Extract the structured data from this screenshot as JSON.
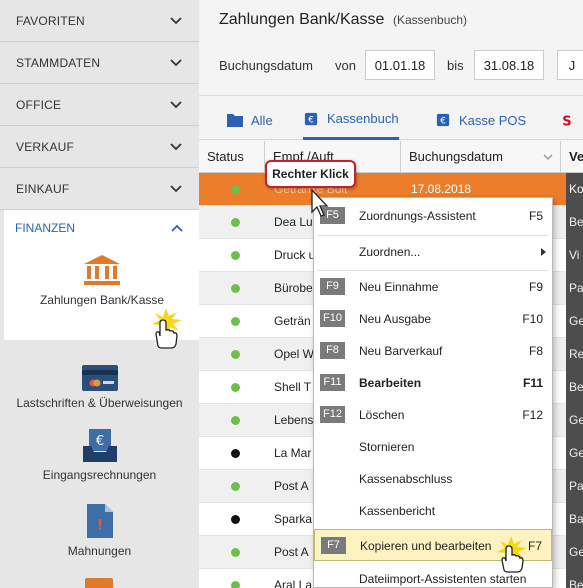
{
  "sidebar": {
    "sections": [
      {
        "label": "FAVORITEN"
      },
      {
        "label": "STAMMDATEN"
      },
      {
        "label": "OFFICE"
      },
      {
        "label": "VERKAUF"
      },
      {
        "label": "EINKAUF"
      }
    ],
    "finanzen": {
      "label": "FINANZEN",
      "active_item": "Zahlungen Bank/Kasse"
    },
    "items": [
      {
        "label": "Lastschriften & Überweisungen"
      },
      {
        "label": "Eingangsrechnungen"
      },
      {
        "label": "Mahnungen"
      }
    ]
  },
  "header": {
    "title": "Zahlungen Bank/Kasse",
    "subtitle": "(Kassenbuch)",
    "date_label": "Buchungsdatum",
    "from_label": "von",
    "from_value": "01.01.18",
    "to_label": "bis",
    "to_value": "31.08.18",
    "extra_button": "J"
  },
  "tabs": [
    {
      "label": "Alle"
    },
    {
      "label": "Kassenbuch"
    },
    {
      "label": "Kasse POS"
    }
  ],
  "table": {
    "headers": {
      "status": "Status",
      "empf": "Empf./Auft",
      "datum": "Buchungsdatum",
      "ver": "Ve"
    },
    "rows": [
      {
        "status": "green",
        "empf": "Getränke Bolt",
        "datum": "17.08.2018",
        "ver": "Ko"
      },
      {
        "status": "green",
        "empf": "Dea Lu",
        "datum": "",
        "ver": "Be"
      },
      {
        "status": "green",
        "empf": "Druck u",
        "datum": "",
        "ver": "Vi"
      },
      {
        "status": "green",
        "empf": "Bürobe",
        "datum": "",
        "ver": "Pa"
      },
      {
        "status": "green",
        "empf": "Geträn",
        "datum": "",
        "ver": "Ge"
      },
      {
        "status": "green",
        "empf": "Opel W",
        "datum": "",
        "ver": "Re"
      },
      {
        "status": "green",
        "empf": "Shell T",
        "datum": "",
        "ver": "Be"
      },
      {
        "status": "green",
        "empf": "Lebens",
        "datum": "",
        "ver": "Ge"
      },
      {
        "status": "black",
        "empf": "La Mar",
        "datum": "",
        "ver": "Ge"
      },
      {
        "status": "green",
        "empf": "Post A",
        "datum": "",
        "ver": "Pa"
      },
      {
        "status": "black",
        "empf": "Sparka",
        "datum": "",
        "ver": "Ba"
      },
      {
        "status": "green",
        "empf": "Post A",
        "datum": "",
        "ver": "Ge"
      },
      {
        "status": "green",
        "empf": "Aral La",
        "datum": "",
        "ver": "Be"
      }
    ]
  },
  "callout": "Rechter Klick",
  "context_menu": {
    "items": [
      {
        "key": "F5",
        "label": "Zuordnungs-Assistent",
        "shortcut": "F5"
      },
      {
        "key": "",
        "label": "Zuordnen...",
        "shortcut": ""
      },
      {
        "key": "F9",
        "label": "Neu Einnahme",
        "shortcut": "F9"
      },
      {
        "key": "F10",
        "label": "Neu Ausgabe",
        "shortcut": "F10"
      },
      {
        "key": "F8",
        "label": "Neu Barverkauf",
        "shortcut": "F8"
      },
      {
        "key": "F11",
        "label": "Bearbeiten",
        "shortcut": "F11"
      },
      {
        "key": "F12",
        "label": "Löschen",
        "shortcut": "F12"
      },
      {
        "key": "",
        "label": "Stornieren",
        "shortcut": ""
      },
      {
        "key": "",
        "label": "Kassenabschluss",
        "shortcut": ""
      },
      {
        "key": "",
        "label": "Kassenbericht",
        "shortcut": ""
      },
      {
        "key": "F7",
        "label": "Kopieren und bearbeiten",
        "shortcut": "F7"
      },
      {
        "key": "",
        "label": "Dateiimport-Assistenten starten",
        "shortcut": ""
      }
    ]
  },
  "colors": {
    "accent": "#2a62b3",
    "selected_row": "#ec7d2b",
    "status_green": "#6cc04a",
    "status_black": "#111111",
    "bank_icon": "#e07a2a"
  }
}
